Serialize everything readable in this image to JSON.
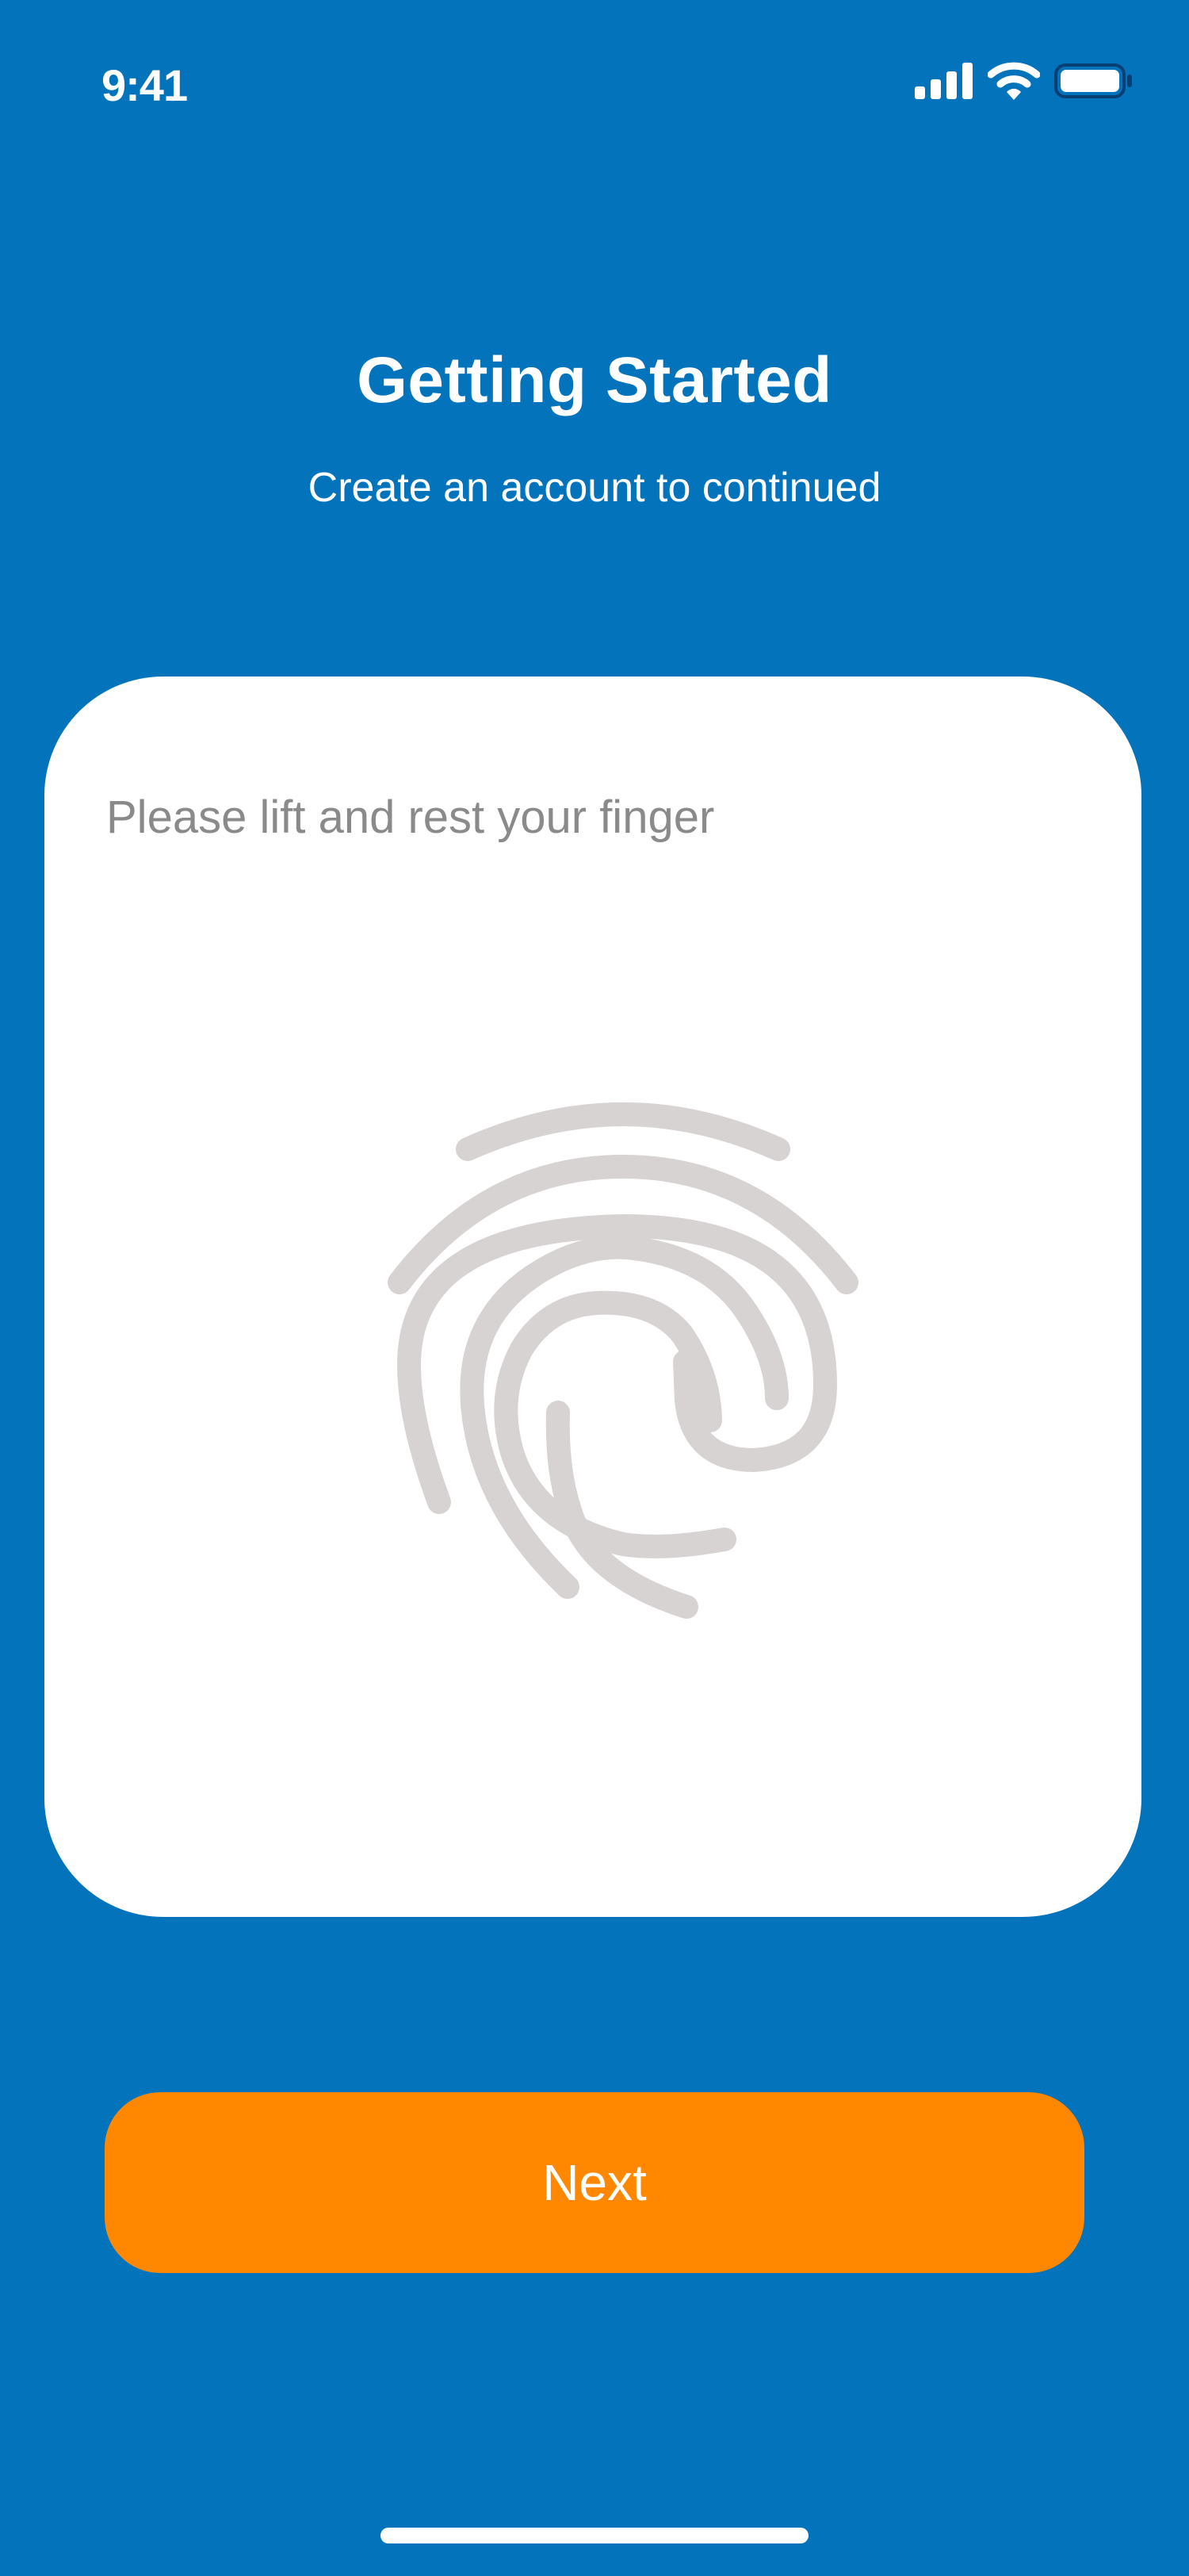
{
  "status_bar": {
    "time": "9:41",
    "icons": [
      "cellular-signal-icon",
      "wifi-icon",
      "battery-icon"
    ]
  },
  "header": {
    "title": "Getting Started",
    "subtitle": "Create an account to continued"
  },
  "card": {
    "prompt": "Please lift and rest your finger",
    "icon": "fingerprint-icon"
  },
  "actions": {
    "next_label": "Next"
  },
  "colors": {
    "background": "#0373BC",
    "card": "#FFFFFF",
    "button": "#FF8800",
    "fingerprint": "#D8D3D3",
    "prompt_text": "#8A8A8A"
  }
}
